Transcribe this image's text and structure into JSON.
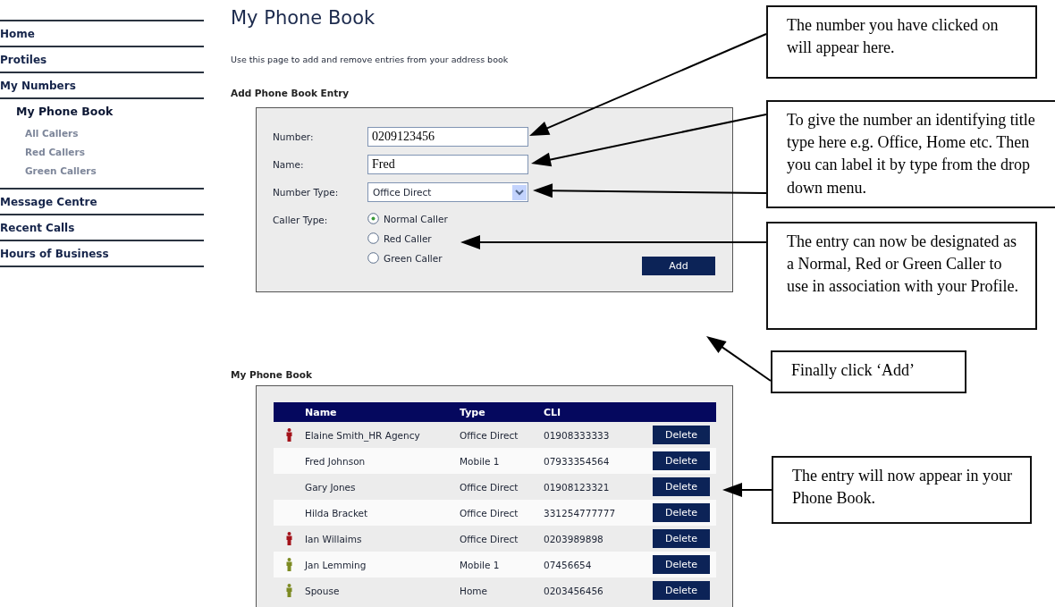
{
  "sidebar": {
    "items": [
      {
        "label": "Home",
        "selected": false
      },
      {
        "label": "Protiles",
        "selected": false
      },
      {
        "label": "My Numbers",
        "selected": false,
        "children": [
          {
            "label": "My Phone Book",
            "selected": true,
            "children": [
              {
                "label": "All Callers",
                "selected": false
              },
              {
                "label": "Red Callers",
                "selected": false
              },
              {
                "label": "Green Callers",
                "selected": false
              }
            ]
          }
        ]
      },
      {
        "label": "Message Centre",
        "selected": false
      },
      {
        "label": "Recent Calls",
        "selected": false
      },
      {
        "label": "Hours of Business",
        "selected": false
      }
    ]
  },
  "page": {
    "title": "My Phone Book",
    "intro": "Use this page to add and remove entries from your address book"
  },
  "add_form": {
    "heading": "Add Phone Book Entry",
    "fields": [
      {
        "kind": "text",
        "label": "Number:",
        "value": "0209123456"
      },
      {
        "kind": "text",
        "label": "Name:",
        "value": "Fred"
      },
      {
        "kind": "select",
        "label": "Number Type:",
        "value": "Office Direct"
      },
      {
        "kind": "radio",
        "label": "Caller Type:",
        "options": [
          {
            "label": "Normal Caller",
            "selected": true
          },
          {
            "label": "Red Caller",
            "selected": false
          },
          {
            "label": "Green Caller",
            "selected": false
          }
        ]
      }
    ],
    "button": "Add"
  },
  "phone_book": {
    "heading": "My Phone Book",
    "columns": [
      "Name",
      "Type",
      "CLI"
    ],
    "rows": [
      {
        "color": "#a3121a",
        "name": "Elaine Smith_HR Agency",
        "type": "Office Direct",
        "cli": "01908333333",
        "action": "Delete"
      },
      {
        "name": "Fred Johnson",
        "type": "Mobile 1",
        "cli": "07933354564",
        "action": "Delete"
      },
      {
        "name": "Gary Jones",
        "type": "Office Direct",
        "cli": "01908123321",
        "action": "Delete"
      },
      {
        "name": "Hilda Bracket",
        "type": "Office Direct",
        "cli": "331254777777",
        "action": "Delete"
      },
      {
        "color": "#a3121a",
        "name": "Ian Willaims",
        "type": "Office Direct",
        "cli": "0203989898",
        "action": "Delete"
      },
      {
        "color": "#7c8a22",
        "name": "Jan Lemming",
        "type": "Mobile 1",
        "cli": "07456654",
        "action": "Delete"
      },
      {
        "color": "#7c8a22",
        "name": "Spouse",
        "type": "Home",
        "cli": "0203456456",
        "action": "Delete"
      }
    ]
  },
  "callouts": [
    {
      "text": "The number you have clicked on will appear here."
    },
    {
      "text": "To give the number an identifying title type here e.g. Office, Home etc. Then you can label it by type from the drop down menu."
    },
    {
      "text": "The entry can now be designated as a Normal, Red or Green Caller to use in association with your Profile."
    },
    {
      "text": "Finally click ‘Add’"
    },
    {
      "text": "The entry will now appear in your Phone Book."
    }
  ]
}
